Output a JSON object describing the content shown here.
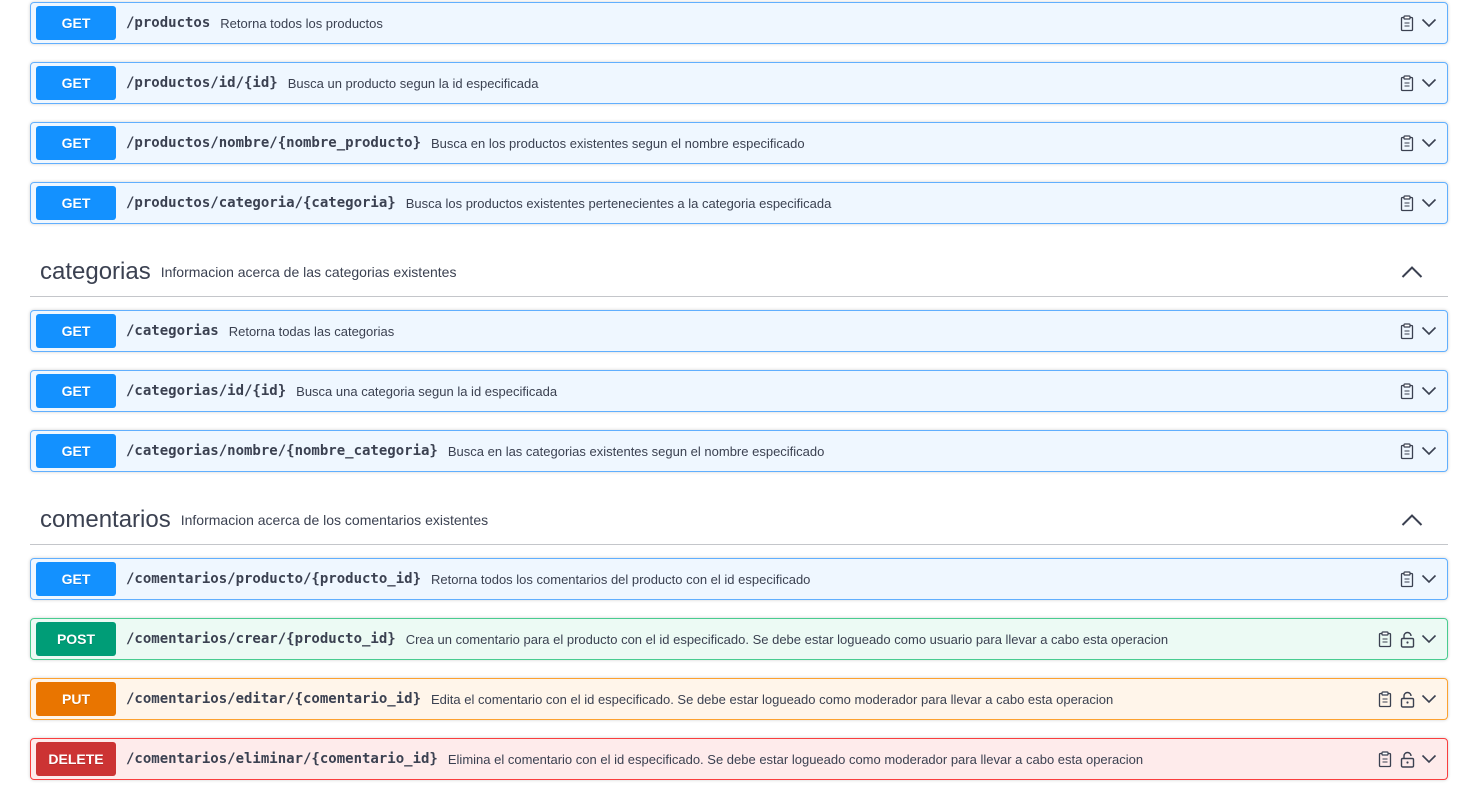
{
  "groups": [
    {
      "endpoints": [
        {
          "method": "GET",
          "path": "/productos",
          "summary": "Retorna todos los productos",
          "secured": false
        },
        {
          "method": "GET",
          "path": "/productos/id/{id}",
          "summary": "Busca un producto segun la id especificada",
          "secured": false
        },
        {
          "method": "GET",
          "path": "/productos/nombre/{nombre_producto}",
          "summary": "Busca en los productos existentes segun el nombre especificado",
          "secured": false
        },
        {
          "method": "GET",
          "path": "/productos/categoria/{categoria}",
          "summary": "Busca los productos existentes pertenecientes a la categoria especificada",
          "secured": false
        }
      ]
    },
    {
      "name": "categorias",
      "description": "Informacion acerca de las categorias existentes",
      "endpoints": [
        {
          "method": "GET",
          "path": "/categorias",
          "summary": "Retorna todas las categorias",
          "secured": false
        },
        {
          "method": "GET",
          "path": "/categorias/id/{id}",
          "summary": "Busca una categoria segun la id especificada",
          "secured": false
        },
        {
          "method": "GET",
          "path": "/categorias/nombre/{nombre_categoria}",
          "summary": "Busca en las categorias existentes segun el nombre especificado",
          "secured": false
        }
      ]
    },
    {
      "name": "comentarios",
      "description": "Informacion acerca de los comentarios existentes",
      "endpoints": [
        {
          "method": "GET",
          "path": "/comentarios/producto/{producto_id}",
          "summary": "Retorna todos los comentarios del producto con el id especificado",
          "secured": false
        },
        {
          "method": "POST",
          "path": "/comentarios/crear/{producto_id}",
          "summary": "Crea un comentario para el producto con el id especificado. Se debe estar logueado como usuario para llevar a cabo esta operacion",
          "secured": true
        },
        {
          "method": "PUT",
          "path": "/comentarios/editar/{comentario_id}",
          "summary": "Edita el comentario con el id especificado. Se debe estar logueado como moderador para llevar a cabo esta operacion",
          "secured": true
        },
        {
          "method": "DELETE",
          "path": "/comentarios/eliminar/{comentario_id}",
          "summary": "Elimina el comentario con el id especificado. Se debe estar logueado como moderador para llevar a cabo esta operacion",
          "secured": true
        }
      ]
    }
  ],
  "colors": {
    "get": "#1391ff",
    "post": "#009d77",
    "put": "#e97500",
    "delete": "#cc3333"
  },
  "icons": {
    "copy": "clipboard-icon",
    "lock": "lock-icon",
    "expand": "chevron-down-icon",
    "collapse": "chevron-up-icon"
  }
}
